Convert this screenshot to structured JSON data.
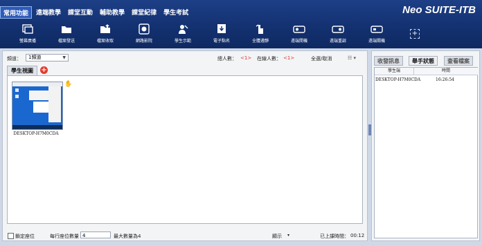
{
  "menu": {
    "tabs": [
      "常用功能",
      "遠端教學",
      "課堂互動",
      "輔助教學",
      "課堂紀律",
      "學生考試"
    ],
    "active_index": 0
  },
  "brand": "Neo SUITE-ITB",
  "toolbar": {
    "items": [
      {
        "label": "螢幕廣播",
        "icon": "screen-broadcast-icon"
      },
      {
        "label": "檔案發送",
        "icon": "folder-send-icon"
      },
      {
        "label": "檔案收取",
        "icon": "folder-receive-icon"
      },
      {
        "label": "網路影院",
        "icon": "media-play-icon"
      },
      {
        "label": "學生示範",
        "icon": "student-demo-icon"
      },
      {
        "label": "電子點名",
        "icon": "roll-call-icon"
      },
      {
        "label": "全體遵靜",
        "icon": "silence-icon"
      },
      {
        "label": "遠端開機",
        "icon": "remote-on-icon"
      },
      {
        "label": "遠端重啟",
        "icon": "remote-restart-icon"
      },
      {
        "label": "遠端關機",
        "icon": "remote-off-icon"
      }
    ],
    "add_icon": "add-tool-icon"
  },
  "controls": {
    "channel_label": "頻道：",
    "channel_value": "1頻道",
    "total_label": "總人數：",
    "total_value": "<1>",
    "online_label": "在線人數：",
    "online_value": "<1>",
    "select_all": "全選/取消"
  },
  "view": {
    "tab_label": "學生視圖",
    "students": [
      {
        "name": "DESKTOP-H7M0CDA"
      }
    ]
  },
  "bottom": {
    "lock_label": "鎖定座位",
    "per_row_label": "每行座位數量",
    "per_row_value": "4",
    "max_label": "最大數量為4",
    "display_label": "顯示",
    "elapsed_label": "已上課時間：",
    "elapsed_value": "00:12"
  },
  "right": {
    "tabs": [
      "收發訊息",
      "舉手狀態",
      "查看檔案"
    ],
    "active_index": 1,
    "columns": [
      "學生端",
      "時間"
    ],
    "rows": [
      {
        "student": "DESKTOP-H7M0CDA",
        "time": "16:26:54"
      }
    ]
  }
}
